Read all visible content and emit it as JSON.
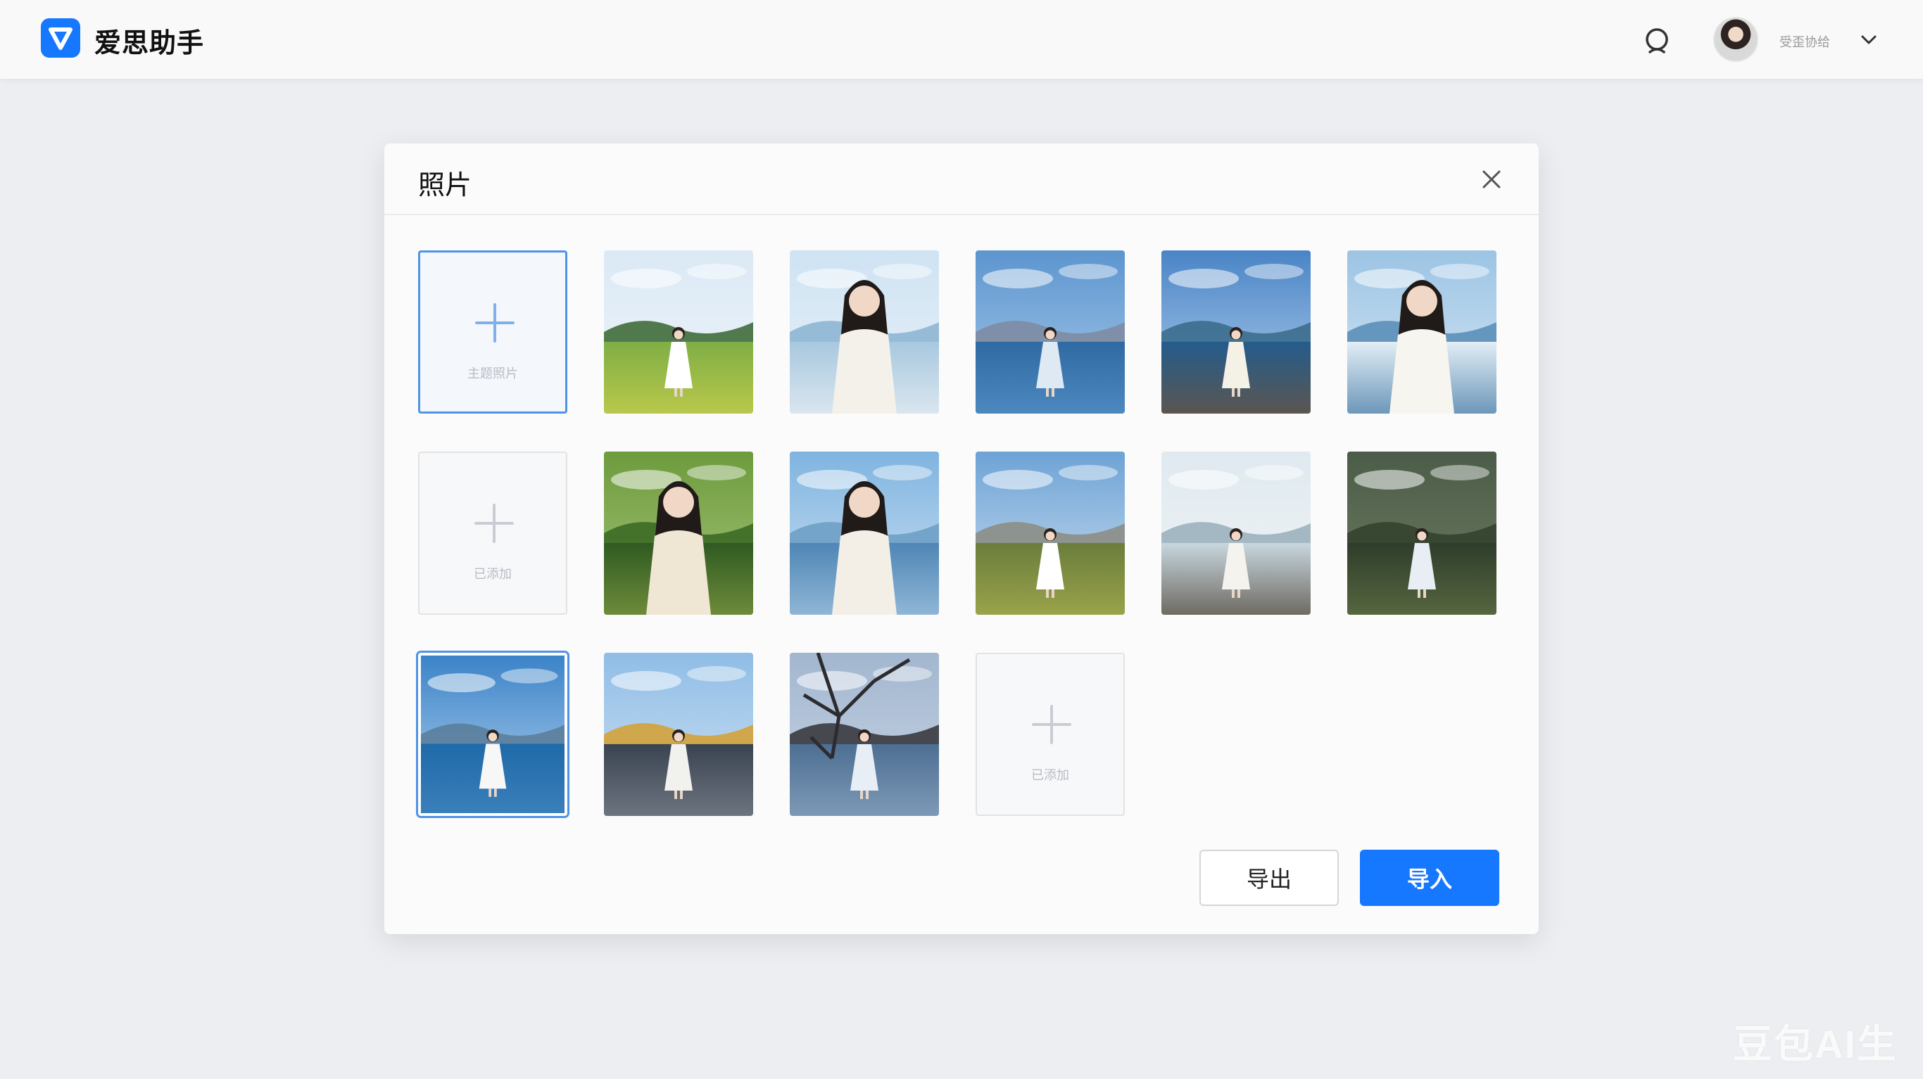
{
  "app": {
    "name": "爱思助手",
    "logo_icon": "v-logo-icon"
  },
  "header": {
    "search_icon": "search-icon",
    "user_name": "受歪协给",
    "dropdown_icon": "chevron-down-icon"
  },
  "dialog": {
    "title": "照片",
    "close_icon": "close-icon",
    "tiles": [
      {
        "kind": "add",
        "hint": "主题照片",
        "active": true
      },
      {
        "kind": "photo",
        "scene": "meadow"
      },
      {
        "kind": "photo",
        "scene": "sky-bouquet"
      },
      {
        "kind": "photo",
        "scene": "sea-mountains"
      },
      {
        "kind": "photo",
        "scene": "rocky-coast"
      },
      {
        "kind": "photo",
        "scene": "waves-portrait"
      },
      {
        "kind": "add",
        "hint": "已添加",
        "active": false
      },
      {
        "kind": "photo",
        "scene": "sunhat-trees"
      },
      {
        "kind": "photo",
        "scene": "face-sky"
      },
      {
        "kind": "photo",
        "scene": "grassland-hills"
      },
      {
        "kind": "photo",
        "scene": "misty-lake"
      },
      {
        "kind": "photo",
        "scene": "tall-reeds"
      },
      {
        "kind": "photo",
        "scene": "lake-selected",
        "selected": true
      },
      {
        "kind": "photo",
        "scene": "yellow-town"
      },
      {
        "kind": "photo",
        "scene": "blossom-tree"
      },
      {
        "kind": "add",
        "hint": "已添加",
        "active": false
      }
    ],
    "export_label": "导出",
    "import_label": "导入"
  },
  "colors": {
    "accent": "#1677ff",
    "selection": "#4f93e6"
  },
  "watermark": "豆包AI生成"
}
